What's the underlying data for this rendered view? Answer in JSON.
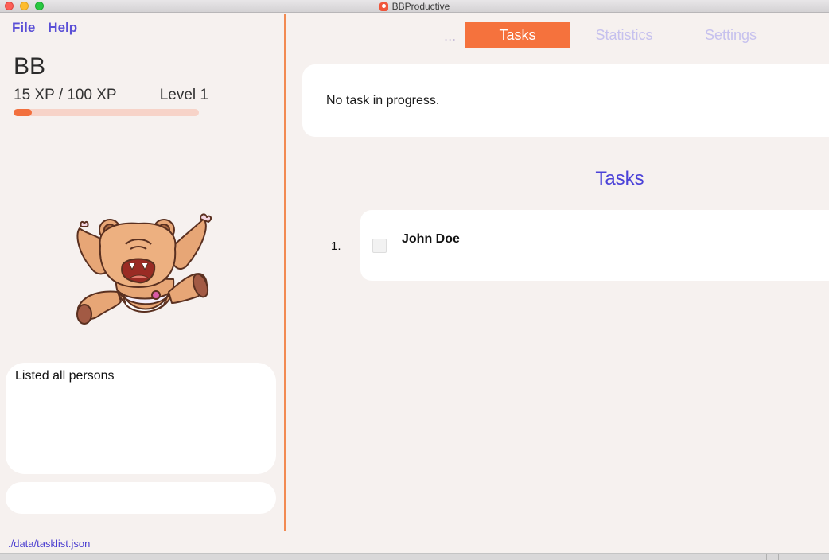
{
  "window": {
    "title": "BBProductive"
  },
  "menu": {
    "file": "File",
    "help": "Help"
  },
  "profile": {
    "name": "BB",
    "xp_text": "15 XP / 100 XP",
    "level_text": "Level 1",
    "xp_fraction": 0.1
  },
  "result": {
    "message": "Listed all persons"
  },
  "command": {
    "value": ""
  },
  "status": {
    "path": "./data/tasklist.json"
  },
  "tabs": {
    "overflow": "...",
    "tasks": "Tasks",
    "statistics": "Statistics",
    "settings": "Settings"
  },
  "progress": {
    "text": "No task in progress."
  },
  "tasks": {
    "heading": "Tasks",
    "items": [
      {
        "index": "1.",
        "name": "John Doe",
        "done": false
      }
    ]
  },
  "colors": {
    "accent": "#f5723d",
    "link": "#5a4fd6",
    "heading": "#4b42d8"
  },
  "icons": {
    "mascot": "bear-mascot-icon",
    "app": "app-icon"
  }
}
